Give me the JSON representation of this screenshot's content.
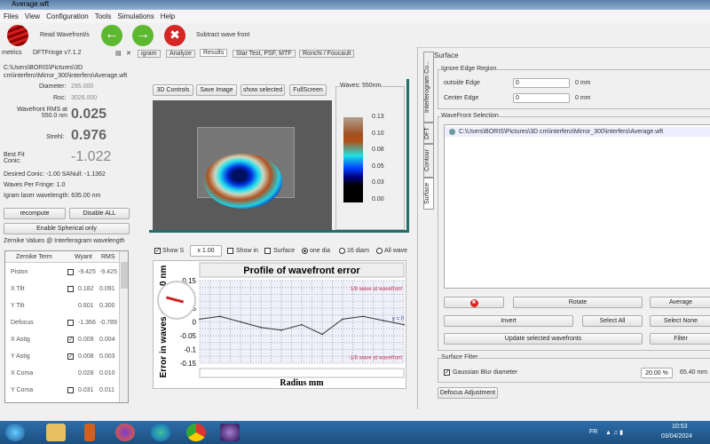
{
  "window": {
    "title": "Average.wft"
  },
  "menu": [
    "Files",
    "View",
    "Configuration",
    "Tools",
    "Simulations",
    "Help"
  ],
  "toolbar": {
    "read": "Read Wavefront/s",
    "subtract": "Subtract wave front"
  },
  "dock": {
    "left_title": "metrics",
    "version": "DFTFringe v7.1.2",
    "tabs": [
      "igram",
      "Analyze",
      "Results",
      "Star Test, PSF, MTF",
      "Ronchi / Foucault"
    ]
  },
  "metrics": {
    "path": "C:\\Users\\BORIS\\Pictures\\3D cm\\interfero\\Mirror_300\\interfero\\Average.wft",
    "diameter_label": "Diameter:",
    "diameter": "295.000",
    "roc_label": "Roc:",
    "roc": "3026.000",
    "rms_label": "Wavefront RMS at 550.0 nm",
    "rms": "0.025",
    "strehl_label": "Strehl:",
    "strehl": "0.976",
    "conic_label": "Best Fit Conic:",
    "conic": "-1.022",
    "desired": "Desired Conic: -1.00 SANull: -1.1362",
    "waves": "Waves Per Fringe: 1.0",
    "laser": "Igram laser wavelength: 635.00 nm",
    "recompute": "recompute",
    "disable_all": "Disable ALL",
    "enable_spherical": "Enable Spherical only",
    "zernike_title": "Zernike Values @ Interferogram wavelength"
  },
  "zernike": {
    "headers": [
      "Zernike Term",
      "Wyant",
      "RMS"
    ],
    "rows": [
      {
        "term": "Piston",
        "cb": "empty",
        "wyant": "-9.425",
        "rms": "-9.425"
      },
      {
        "term": "X Tilt",
        "cb": "empty",
        "wyant": "0.182",
        "rms": "0.091"
      },
      {
        "term": "Y Tilt",
        "cb": "none",
        "wyant": "0.601",
        "rms": "0.300"
      },
      {
        "term": "Defocus",
        "cb": "empty",
        "wyant": "-1.366",
        "rms": "-0.789"
      },
      {
        "term": "X Astig",
        "cb": "checked",
        "wyant": "0.009",
        "rms": "0.004"
      },
      {
        "term": "Y Astig",
        "cb": "checked",
        "wyant": "0.008",
        "rms": "0.003"
      },
      {
        "term": "X Coma",
        "cb": "none",
        "wyant": "0.028",
        "rms": "0.010"
      },
      {
        "term": "Y Coma",
        "cb": "empty",
        "wyant": "0.031",
        "rms": "0.011"
      }
    ]
  },
  "view3d": {
    "buttons": [
      "3D Controls",
      "Save Image",
      "show selected",
      "FullScreen"
    ],
    "legend_title": "Waves: 550nm",
    "legend_ticks": [
      "0.13",
      "0.10",
      "0.08",
      "0.05",
      "0.03",
      "0.00"
    ]
  },
  "options": {
    "show_s": "Show S",
    "spin": "x 1.00",
    "show_in": "Show in",
    "surface": "Surface",
    "one_dia": "one dia",
    "sixteen": "16 diam",
    "all_wave": "All wave"
  },
  "chart_data": {
    "type": "line",
    "title": "Profile of wavefront error",
    "xlabel": "Radius mm",
    "ylabel": "Error in waves of 550.0 nm",
    "ylim": [
      -0.15,
      0.15
    ],
    "yticks": [
      "0.15",
      "0.1",
      "0.05",
      "0",
      "-0.05",
      "-0.1",
      "-0.15"
    ],
    "annotations": [
      "1/8 wave at wavefront",
      "y = 0",
      "-1/8 wave at wavefront"
    ],
    "x": [
      0,
      1,
      2,
      3,
      4,
      5,
      6,
      7,
      8,
      9,
      10
    ],
    "values": [
      0.01,
      0.02,
      0.0,
      -0.02,
      -0.03,
      -0.01,
      -0.045,
      0.01,
      0.02,
      0.005,
      -0.01
    ]
  },
  "surface": {
    "title": "Surface",
    "ignore_group": "Ignore Edge Region",
    "outside_label": "outside Edge",
    "outside_val": "0",
    "outside_unit": "0 mm",
    "center_label": "Center Edge",
    "center_val": "0",
    "center_unit": "0 mm",
    "selection_group": "WaveFront Selection",
    "file": "C:\\Users\\BORIS\\Pictures\\3D cm\\interfero\\Mirror_300\\interfero\\Average.wft",
    "rotate": "Rotate",
    "average": "Average",
    "invert": "Invert",
    "select_all": "Select All",
    "select_none": "Select None",
    "update": "Update selected wavefronts",
    "filter": "Filter",
    "filter_group": "Surface Filter",
    "gaussian": "Gaussian Blur diameter",
    "blur_val": "20.00 %",
    "blur_mm": "65.40 mm",
    "defocus": "Defocus Adjustment",
    "vtabs": [
      "Interferogram Co...",
      "DFT",
      "Contour",
      "Surface"
    ]
  },
  "taskbar": {
    "lang": "FR",
    "time": "10:53",
    "date": "03/04/2024"
  },
  "colors": {
    "teal": "#1f6f6a",
    "dark": "#555555"
  }
}
